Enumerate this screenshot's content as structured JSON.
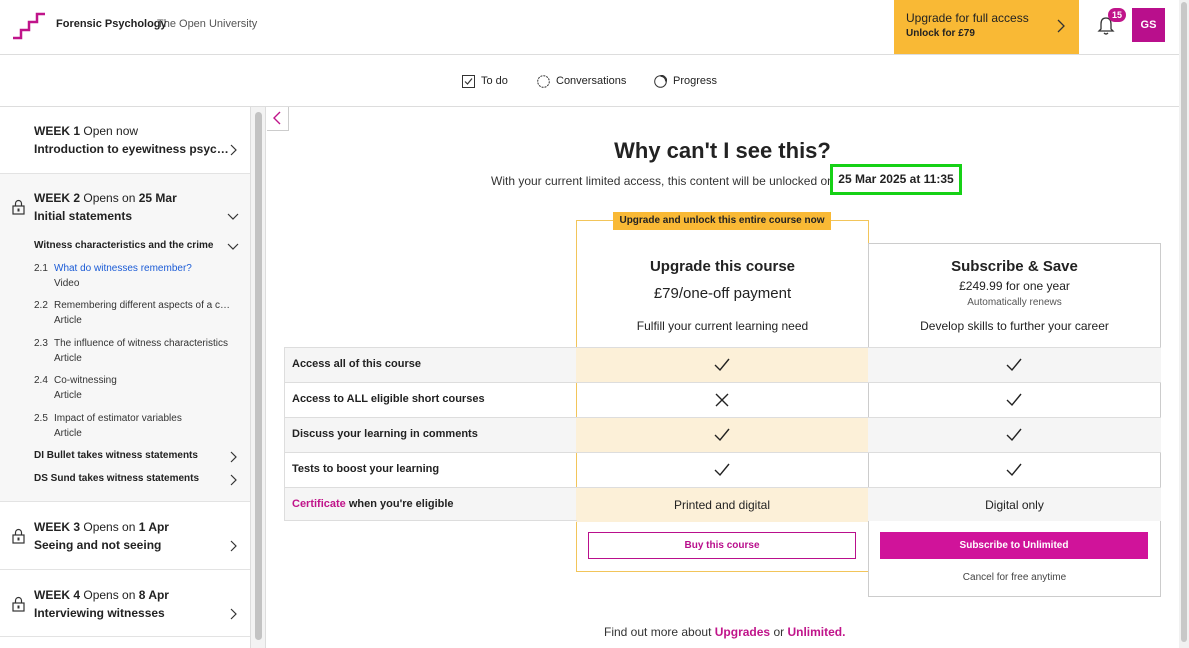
{
  "header": {
    "course_title": "Forensic Psychology",
    "org": "The Open University",
    "upgrade_main": "Upgrade for full access",
    "upgrade_sub": "Unlock for £79",
    "notification_count": "15",
    "avatar_initials": "GS",
    "brand_color": "#b90f8c",
    "upgrade_color": "#f9b935"
  },
  "tabs": [
    {
      "label": "To do",
      "icon": "checkbox-icon"
    },
    {
      "label": "Conversations",
      "icon": "chat-circle-icon"
    },
    {
      "label": "Progress",
      "icon": "progress-ring-icon"
    }
  ],
  "sidebar": {
    "week1": {
      "label_prefix": "WEEK 1",
      "label_status": "Open now",
      "name": "Introduction to eyewitness psyc…"
    },
    "week2": {
      "label_prefix": "WEEK 2",
      "label_status": "Opens on",
      "label_date": "25 Mar",
      "name": "Initial statements",
      "section": "Witness characteristics and the crime",
      "steps": [
        {
          "num": "2.1",
          "title": "What do witnesses remember?",
          "type": "Video"
        },
        {
          "num": "2.2",
          "title": "Remembering different aspects of a c…",
          "type": "Article"
        },
        {
          "num": "2.3",
          "title": "The influence of witness characteristics",
          "type": "Article"
        },
        {
          "num": "2.4",
          "title": "Co-witnessing",
          "type": "Article"
        },
        {
          "num": "2.5",
          "title": "Impact of estimator variables",
          "type": "Article"
        }
      ],
      "extra_sections": [
        "DI Bullet takes witness statements",
        "DS Sund takes witness statements"
      ]
    },
    "week3": {
      "label_prefix": "WEEK 3",
      "label_status": "Opens on",
      "label_date": "1 Apr",
      "name": "Seeing and not seeing"
    },
    "week4": {
      "label_prefix": "WEEK 4",
      "label_status": "Opens on",
      "label_date": "8 Apr",
      "name": "Interviewing witnesses"
    }
  },
  "main": {
    "title": "Why can't I see this?",
    "unlock_text": "With your current limited access, this content will be unlocked on",
    "unlock_date": "25 Mar 2025 at 11:35",
    "ribbon": "Upgrade and unlock this entire course now",
    "plan_upgrade": {
      "title": "Upgrade this course",
      "price": "£79/one-off payment",
      "desc": "Fulfill your current learning need",
      "button": "Buy this course"
    },
    "plan_sub": {
      "title": "Subscribe & Save",
      "price_value": "£249.99",
      "price_period": "for one year",
      "note": "Automatically renews",
      "desc": "Develop skills to further your career",
      "button": "Subscribe to Unlimited",
      "cancel_note": "Cancel for free anytime"
    },
    "features": [
      {
        "label": "Access all of this course",
        "upgrade": "check",
        "sub": "check"
      },
      {
        "label": "Access to ALL eligible short courses",
        "upgrade": "cross",
        "sub": "check"
      },
      {
        "label": "Discuss your learning in comments",
        "upgrade": "check",
        "sub": "check"
      },
      {
        "label": "Tests to boost your learning",
        "upgrade": "check",
        "sub": "check"
      }
    ],
    "certificate": {
      "link": "Certificate",
      "rest": "when you're eligible",
      "upgrade_text": "Printed and digital",
      "sub_text": "Digital only"
    },
    "footer": {
      "prefix": "Find out more about",
      "link1": "Upgrades",
      "or": "or",
      "link2": "Unlimited."
    }
  }
}
